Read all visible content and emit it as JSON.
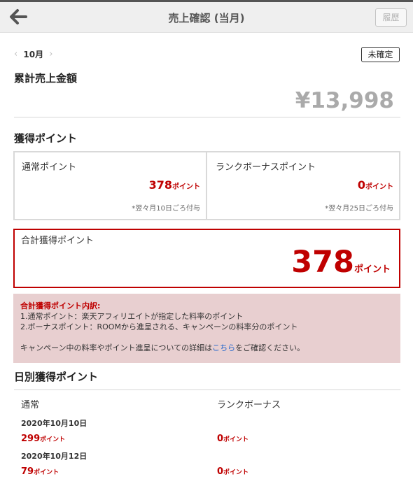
{
  "header": {
    "title": "売上確認 (当月)",
    "history_label": "履歴"
  },
  "period": {
    "month": "10月",
    "status_badge": "未確定"
  },
  "cumulative_sales": {
    "title": "累計売上金額",
    "amount": "¥13,998"
  },
  "earned_points": {
    "title": "獲得ポイント",
    "normal": {
      "label": "通常ポイント",
      "value": "378",
      "unit": "ポイント",
      "note": "*翌々月10日ごろ付与"
    },
    "rank_bonus": {
      "label": "ランクボーナスポイント",
      "value": "0",
      "unit": "ポイント",
      "note": "*翌々月25日ごろ付与"
    },
    "total": {
      "label": "合計獲得ポイント",
      "value": "378",
      "unit": "ポイント"
    }
  },
  "breakdown": {
    "title": "合計獲得ポイント内訳:",
    "line1": "1.通常ポイント：楽天アフィリエイトが指定した料率のポイント",
    "line2": "2.ボーナスポイント：ROOMから進呈される、キャンペーンの料率分のポイント",
    "note_before": "キャンペーン中の料率やポイント進呈についての詳細は",
    "note_link": "こちら",
    "note_after": "をご確認ください。"
  },
  "daily": {
    "title": "日別獲得ポイント",
    "col_normal": "通常",
    "col_rank": "ランクボーナス",
    "rows": [
      {
        "date": "2020年10月10日",
        "normal": "299",
        "rank": "0",
        "unit": "ポイント"
      },
      {
        "date": "2020年10月12日",
        "normal": "79",
        "rank": "0",
        "unit": "ポイント"
      }
    ]
  },
  "colors": {
    "accent_red": "#bf0000",
    "info_bg": "#e8cfd0",
    "header_bg": "#efefef"
  },
  "icons": {
    "back": "arrow-left-icon",
    "prev_month": "chevron-left-icon",
    "next_month": "chevron-right-icon"
  }
}
